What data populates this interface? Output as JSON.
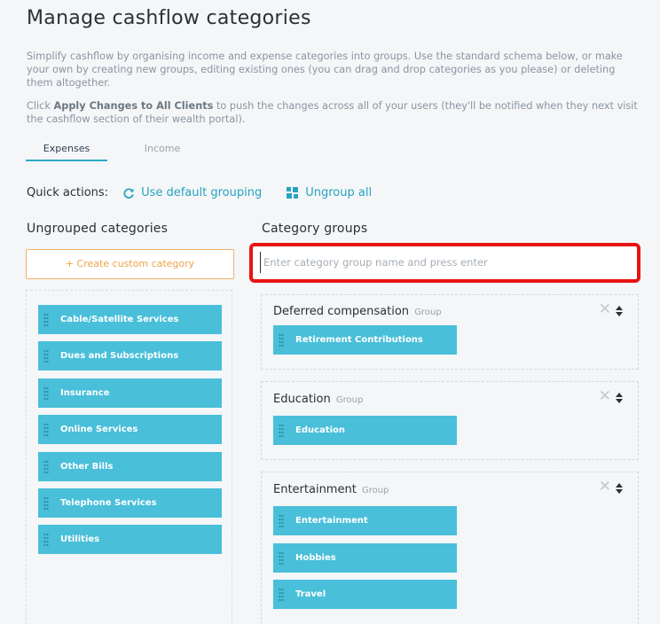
{
  "page": {
    "title": "Manage cashflow categories",
    "intro": "Simplify cashflow by organising income and expense categories into groups. Use the standard schema below, or make your own by creating new groups, editing existing ones (you can drag and drop categories as you please) or deleting them altogether.",
    "apply_prefix": "Click ",
    "apply_bold": "Apply Changes to All Clients",
    "apply_suffix": " to push the changes across all of your users (they'll be notified when they next visit the cashflow section of their wealth portal)."
  },
  "tabs": [
    {
      "label": "Expenses",
      "active": true
    },
    {
      "label": "Income",
      "active": false
    }
  ],
  "quick_actions": {
    "label": "Quick actions:",
    "default_grouping": {
      "label": "Use default grouping",
      "icon": "refresh-icon"
    },
    "ungroup_all": {
      "label": "Ungroup all",
      "icon": "grid-icon"
    }
  },
  "ungrouped": {
    "title": "Ungrouped categories",
    "create_label": "+ Create custom category",
    "items": [
      "Cable/Satellite Services",
      "Dues and Subscriptions",
      "Insurance",
      "Online Services",
      "Other Bills",
      "Telephone Services",
      "Utilities"
    ]
  },
  "groups_section": {
    "title": "Category groups",
    "input_placeholder": "Enter category group name and press enter",
    "input_value": "",
    "group_suffix": "Group",
    "groups": [
      {
        "name": "Deferred compensation",
        "items": [
          "Retirement Contributions"
        ]
      },
      {
        "name": "Education",
        "items": [
          "Education"
        ]
      },
      {
        "name": "Entertainment",
        "items": [
          "Entertainment",
          "Hobbies",
          "Travel"
        ]
      }
    ]
  },
  "colors": {
    "accent": "#27a3c1",
    "chip": "#49bfd9",
    "create_button": "#f0a24a",
    "highlight": "#e81414"
  }
}
